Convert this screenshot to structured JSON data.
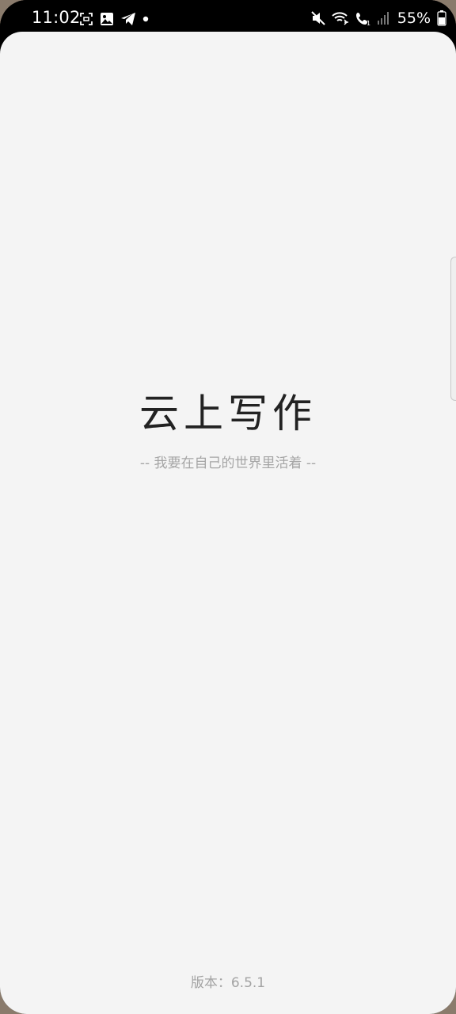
{
  "status_bar": {
    "time": "11:02",
    "battery_percent": "55%",
    "left_icons": [
      "screenshot-icon",
      "image-icon",
      "telegram-icon",
      "notification-dot-icon"
    ],
    "right_icons": [
      "mute-icon",
      "wifi-calling-icon",
      "volte-call-icon",
      "signal-icon",
      "battery-icon"
    ]
  },
  "splash": {
    "app_title": "云上写作",
    "slogan": "-- 我要在自己的世界里活着 --",
    "version": "版本：6.5.1"
  },
  "colors": {
    "background": "#f4f4f4",
    "title": "#222222",
    "subtle_text": "#a5a5a5",
    "status_bar": "#000000"
  }
}
